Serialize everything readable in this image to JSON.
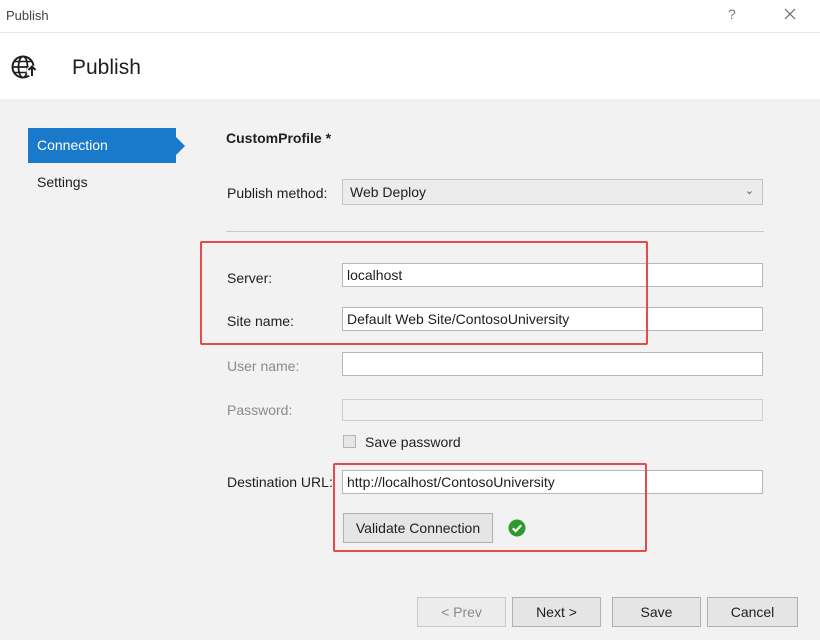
{
  "window": {
    "title": "Publish",
    "help_label": "?",
    "close_icon": "close-icon"
  },
  "header": {
    "icon": "globe-publish-icon",
    "title": "Publish"
  },
  "nav": {
    "items": [
      {
        "label": "Connection",
        "active": true
      },
      {
        "label": "Settings",
        "active": false
      }
    ]
  },
  "form": {
    "profile_name": "CustomProfile *",
    "publish_method": {
      "label": "Publish method:",
      "value": "Web Deploy"
    },
    "server": {
      "label": "Server:",
      "value": "localhost"
    },
    "site_name": {
      "label": "Site name:",
      "value": "Default Web Site/ContosoUniversity"
    },
    "user_name": {
      "label": "User name:",
      "value": ""
    },
    "password": {
      "label": "Password:",
      "value": ""
    },
    "save_password": {
      "label": "Save password",
      "checked": false
    },
    "destination_url": {
      "label": "Destination URL:",
      "value": "http://localhost/ContosoUniversity"
    },
    "validate_button": "Validate Connection",
    "validation_status": "success-check-icon"
  },
  "footer": {
    "prev": "< Prev",
    "next": "Next >",
    "save": "Save",
    "cancel": "Cancel"
  },
  "colors": {
    "accent": "#1979ca",
    "highlight": "#e54b4b",
    "success": "#2e9a2e"
  }
}
